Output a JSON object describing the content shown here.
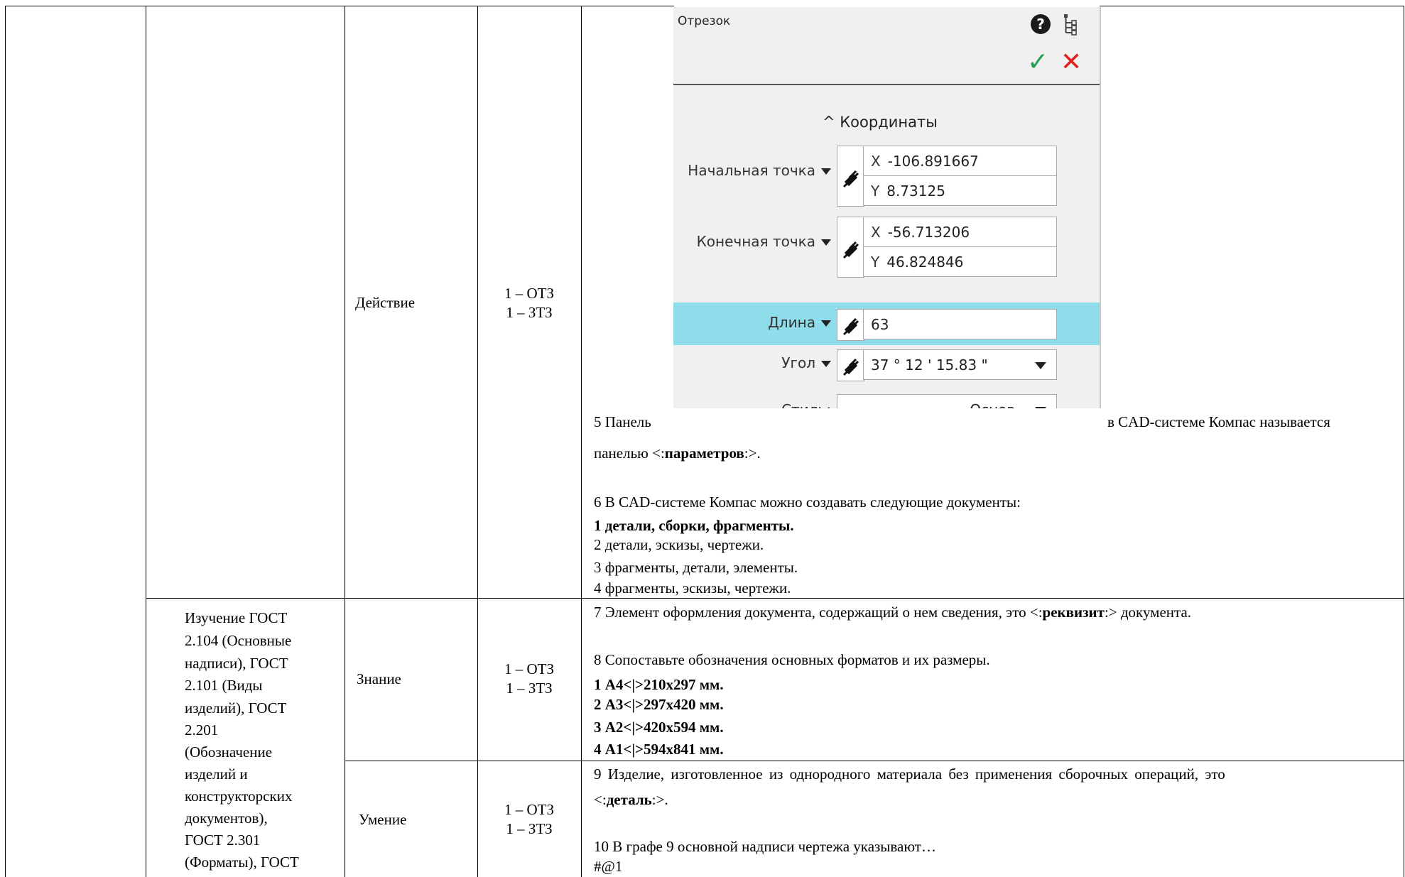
{
  "panel": {
    "title": "Отрезок",
    "help_glyph": "?",
    "ok_glyph": "✓",
    "cancel_glyph": "✕",
    "section": "^ Координаты",
    "start_point_label": "Начальная точка",
    "start_x_axis": "X",
    "start_x": "-106.891667",
    "start_y_axis": "Y",
    "start_y": "8.73125",
    "end_point_label": "Конечная точка",
    "end_x_axis": "X",
    "end_x": "-56.713206",
    "end_y_axis": "Y",
    "end_y": "46.824846",
    "length_label": "Длина",
    "length": "63",
    "angle_label": "Угол",
    "angle": "37 ° 12 ' 15.83 \"",
    "style_label": "Стиль:",
    "style_value": "Основ...",
    "highlight_color": "#8fdcea"
  },
  "rows": [
    {
      "kind": "Действие",
      "tasks": [
        "1 – ОТЗ",
        "1 – ЗТЗ"
      ],
      "q5_prefix": "5 Панель",
      "q5_suffix": "в CAD-системе Компас называется",
      "q5_line2_pre": "панелью <:",
      "q5_answer": "параметров",
      "q5_line2_post": ":>.",
      "q6": "6 В CAD-системе Компас можно создавать следующие документы:",
      "q6_options": [
        "1 детали, сборки, фрагменты.",
        "2 детали, эскизы, чертежи.",
        "3 фрагменты, детали, элементы.",
        "4 фрагменты, эскизы, чертежи."
      ]
    },
    {
      "kind": "Знание",
      "tasks": [
        "1 – ОТЗ",
        "1 – ЗТЗ"
      ],
      "q7_pre": "7 Элемент оформления документа, содержащий о нем сведения, это <:",
      "q7_answer": "реквизит",
      "q7_post": ":> документа.",
      "q8": "8 Сопоставьте обозначения основных форматов и их размеры.",
      "q8_options": [
        "1 А4<|>210х297 мм.",
        "2 А3<|>297х420 мм.",
        "3 А2<|>420х594 мм.",
        "4 А1<|>594х841 мм."
      ]
    },
    {
      "kind": "Умение",
      "tasks": [
        "1 – ОТЗ",
        "1 – ЗТЗ"
      ],
      "q9": "9 Изделие, изготовленное из однородного материала без применения сборочных операций, это",
      "q9_line2_pre": "<:",
      "q9_answer": "деталь",
      "q9_line2_post": ":>.",
      "q10": "10 В графе 9 основной надписи чертежа указывают…",
      "q10_marker": "#@1"
    }
  ],
  "topic_lines": [
    "Изучение ГОСТ",
    "2.104 (Основные",
    "надписи), ГОСТ",
    "2.101 (Виды",
    "изделий), ГОСТ",
    "2.201",
    "(Обозначение",
    "изделий и",
    "конструкторских",
    "документов),",
    "ГОСТ 2.301",
    "(Форматы), ГОСТ"
  ]
}
